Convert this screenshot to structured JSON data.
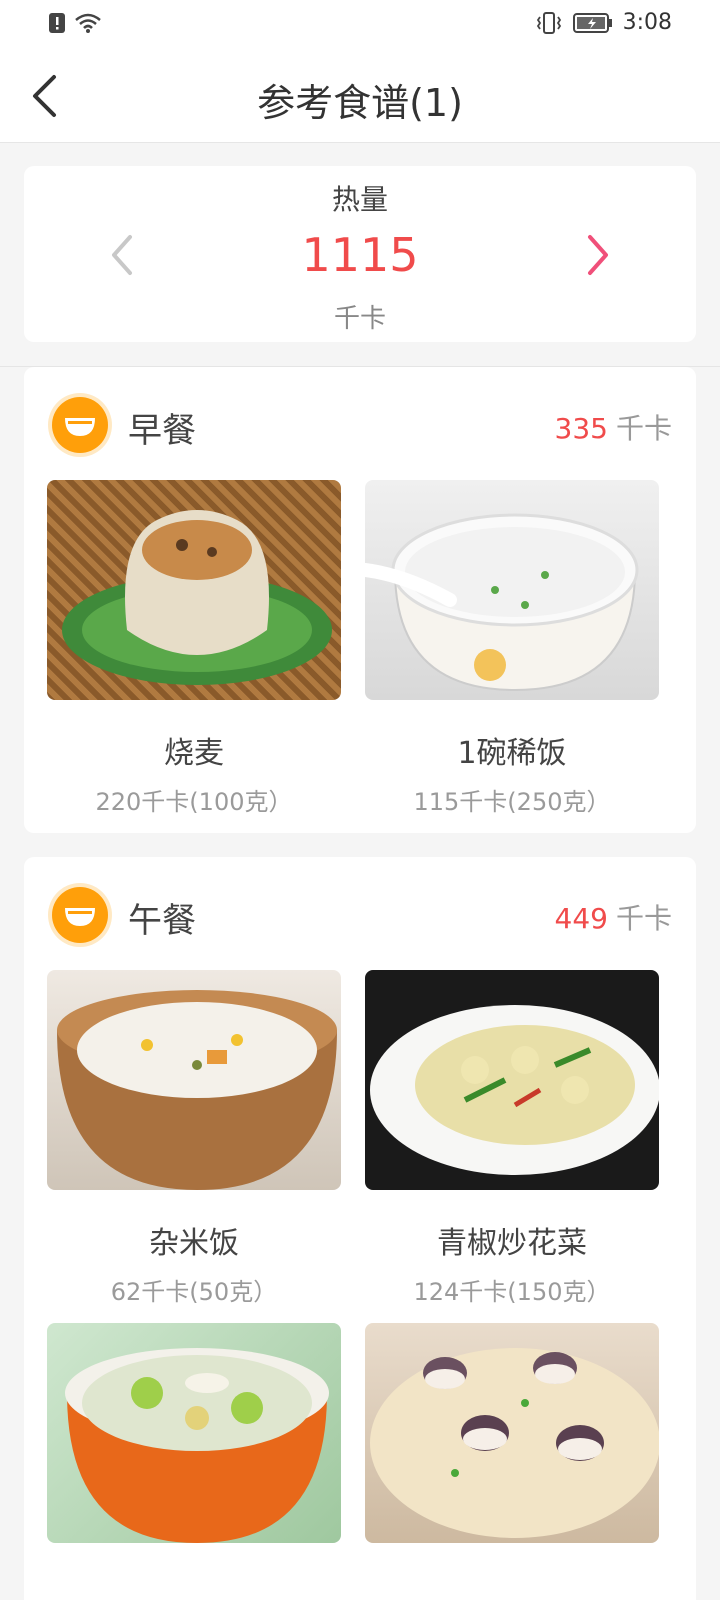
{
  "status_bar": {
    "time": "3:08"
  },
  "header": {
    "title": "参考食谱(1)"
  },
  "calorie": {
    "label": "热量",
    "value": "1115",
    "unit": "千卡",
    "accent": "#f04b4b"
  },
  "meals": [
    {
      "name": "早餐",
      "kcal": "335",
      "kcal_unit": "千卡",
      "foods": [
        {
          "name": "烧麦",
          "detail": "220千卡(100克）"
        },
        {
          "name": "1碗稀饭",
          "detail": "115千卡(250克）"
        }
      ]
    },
    {
      "name": "午餐",
      "kcal": "449",
      "kcal_unit": "千卡",
      "foods": [
        {
          "name": "杂米饭",
          "detail": "62千卡(50克）"
        },
        {
          "name": "青椒炒花菜",
          "detail": "124千卡(150克）"
        },
        {
          "name": "",
          "detail": ""
        },
        {
          "name": "",
          "detail": ""
        }
      ]
    }
  ],
  "colors": {
    "meal_icon": "#ff9f0a",
    "kcal_number": "#f04b4b",
    "next_arrow": "#f0507a"
  }
}
